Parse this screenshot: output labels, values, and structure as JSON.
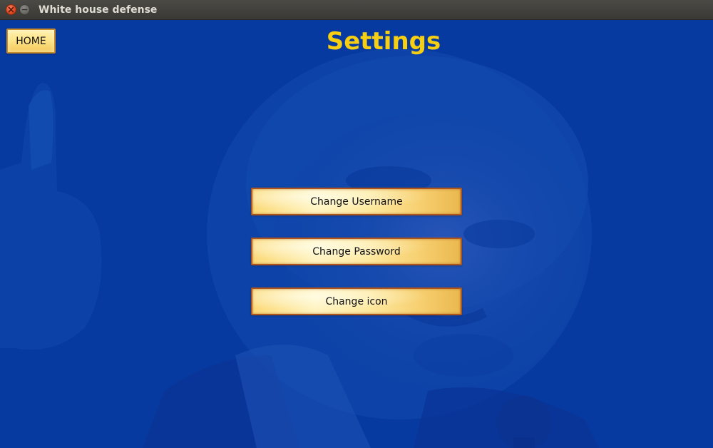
{
  "window": {
    "title": "White house defense"
  },
  "header": {
    "home_label": "HOME",
    "title": "Settings"
  },
  "menu": {
    "items": [
      {
        "label": "Change Username"
      },
      {
        "label": "Change Password"
      },
      {
        "label": "Change icon"
      }
    ]
  },
  "colors": {
    "background": "#0a3a9c",
    "title": "#f6cf12",
    "button_fill": "#fde9a0",
    "button_border": "#b0551c"
  },
  "icons": {
    "close": "close-icon",
    "minimize": "minimize-icon"
  }
}
